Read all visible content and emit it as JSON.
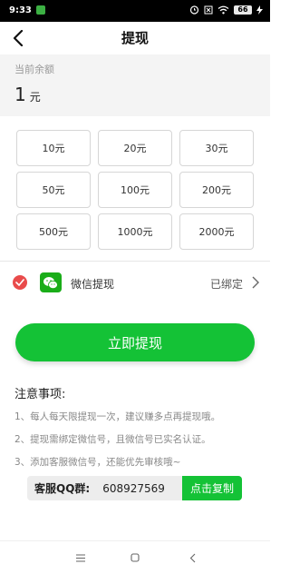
{
  "status_bar": {
    "time": "9:33",
    "battery": "66"
  },
  "header": {
    "title": "提现"
  },
  "balance": {
    "label": "当前余额",
    "value": "1",
    "unit": "元"
  },
  "amounts": [
    "10元",
    "20元",
    "30元",
    "50元",
    "100元",
    "200元",
    "500元",
    "1000元",
    "2000元"
  ],
  "payment": {
    "method": "微信提现",
    "status": "已绑定"
  },
  "withdraw_button": "立即提现",
  "notes": {
    "title": "注意事项:",
    "items": [
      "1、每人每天限提现一次，建议赚多点再提现哦。",
      "2、提现需绑定微信号，且微信号已实名认证。",
      "3、添加客服微信号，还能优先审核哦~"
    ]
  },
  "qq_group": {
    "label": "客服QQ群:",
    "number": "608927569",
    "copy_label": "点击复制"
  },
  "colors": {
    "accent": "#14c236",
    "check": "#e94b4b",
    "wechat": "#1aad19"
  }
}
